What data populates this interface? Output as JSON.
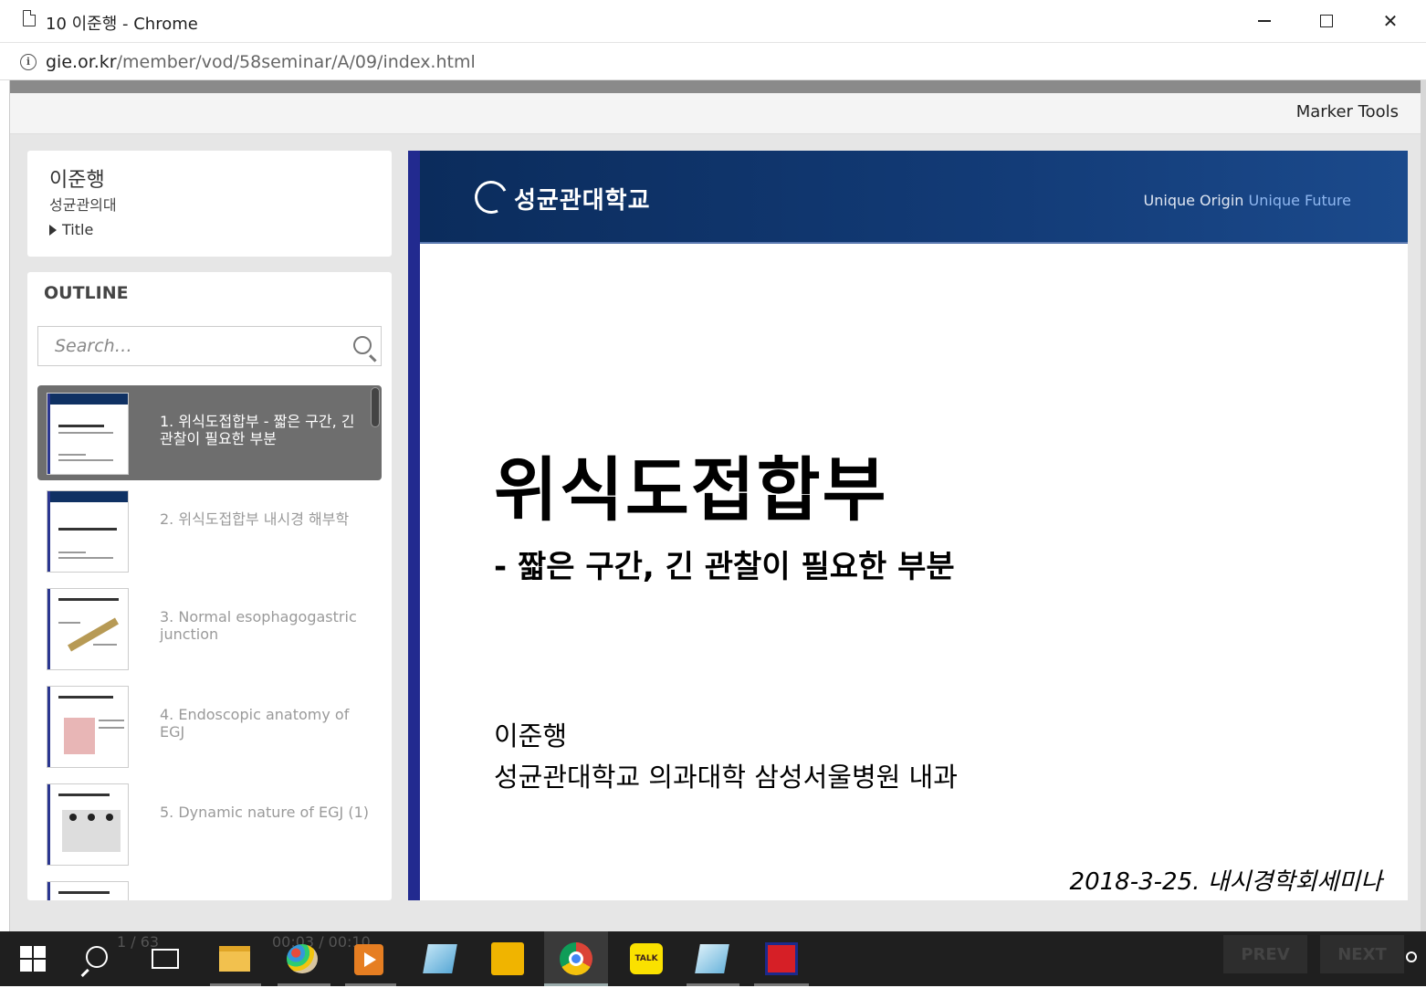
{
  "window": {
    "title": "10 이준행 - Chrome",
    "url_host": "gie.or.kr",
    "url_path": "/member/vod/58seminar/A/09/index.html"
  },
  "toolbar": {
    "marker_tools": "Marker Tools"
  },
  "presenter": {
    "name": "이준행",
    "affiliation": "성균관의대",
    "title_toggle": "Title"
  },
  "outline": {
    "heading": "OUTLINE",
    "search_placeholder": "Search…",
    "items": [
      {
        "label": "1. 위식도접합부 - 짧은 구간, 긴 관찰이 필요한 부분",
        "active": true
      },
      {
        "label": "2. 위식도접합부 내시경 해부학",
        "active": false
      },
      {
        "label": "3. Normal esophagogastric junction",
        "active": false
      },
      {
        "label": "4. Endoscopic anatomy of EGJ",
        "active": false
      },
      {
        "label": "5. Dynamic nature of EGJ (1)",
        "active": false
      }
    ]
  },
  "slide": {
    "logo": "성균관대학교",
    "tagline_a": "Unique Origin",
    "tagline_b": "Unique Future",
    "title": "위식도접합부",
    "subtitle": "- 짧은 구간, 긴 관찰이 필요한 부분",
    "author": "이준행",
    "affiliation": "성균관대학교 의과대학 삼성서울병원 내과",
    "date": "2018-3-25. 내시경학회세미나"
  },
  "player": {
    "counter": "1 / 63",
    "time": "00:03 / 00:10",
    "prev": "PREV",
    "next": "NEXT"
  },
  "taskbar": {
    "kakao_label": "TALK"
  }
}
